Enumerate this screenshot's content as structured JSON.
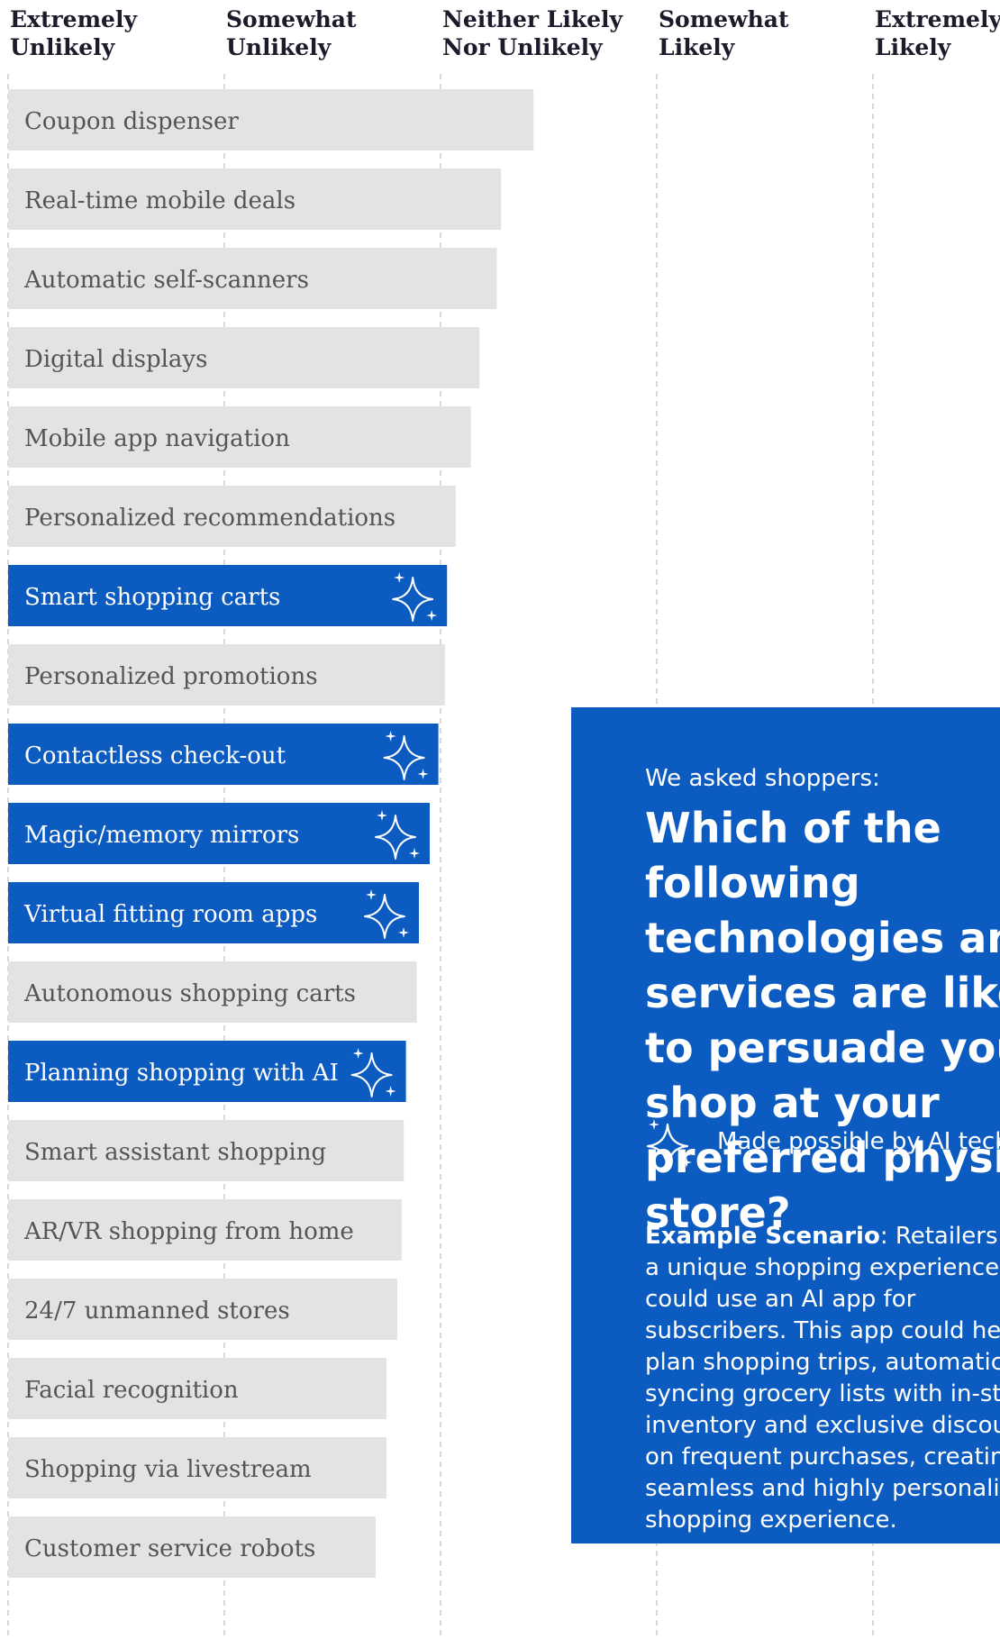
{
  "chart_data": {
    "type": "bar",
    "orientation": "horizontal",
    "columns": [
      "Extremely\nUnlikely",
      "Somewhat\nUnlikely",
      "Neither Likely\nNor Unlikely",
      "Somewhat\nLikely",
      "Extremely\nLikely"
    ],
    "xlim": [
      1,
      5
    ],
    "grid": true,
    "categories": [
      "Coupon dispenser",
      "Real-time mobile deals",
      "Automatic self-scanners",
      "Digital displays",
      "Mobile app navigation",
      "Personalized recommendations",
      "Smart shopping carts",
      "Personalized promotions",
      "Contactless check-out",
      "Magic/memory mirrors",
      "Virtual fitting room apps",
      "Autonomous shopping carts",
      "Planning shopping with AI",
      "Smart assistant shopping",
      "AR/VR shopping from home",
      "24/7 unmanned stores",
      "Facial recognition",
      "Shopping via livestream",
      "Customer service robots"
    ],
    "values": [
      3.43,
      3.28,
      3.26,
      3.18,
      3.14,
      3.07,
      3.03,
      3.02,
      2.99,
      2.95,
      2.9,
      2.89,
      2.84,
      2.83,
      2.82,
      2.8,
      2.75,
      2.75,
      2.7
    ],
    "ai_enabled": [
      false,
      false,
      false,
      false,
      false,
      false,
      true,
      false,
      true,
      true,
      true,
      false,
      true,
      false,
      false,
      false,
      false,
      false,
      false
    ],
    "colors": {
      "bar": "#e3e3e3",
      "ai_bar": "#0b5bc0",
      "label": "#555555",
      "ai_label": "#ffffff",
      "grid": "#cccccc",
      "header": "#1b1b2b"
    }
  },
  "panel": {
    "intro": "We asked shoppers:",
    "question": "Which of the following technologies and services are likely to persuade you to shop at your preferred physical store?",
    "ai_note": "Made possible by AI technology",
    "ai_icon": "sparkle-icon",
    "scenario_label": "Example Scenario",
    "scenario_text": ": Retailers with a unique shopping experience could use an AI app for subscribers. This app could help plan shopping trips, automatically syncing grocery lists with in-store inventory and exclusive discounts on frequent purchases, creating a seamless and highly personalized shopping experience."
  }
}
